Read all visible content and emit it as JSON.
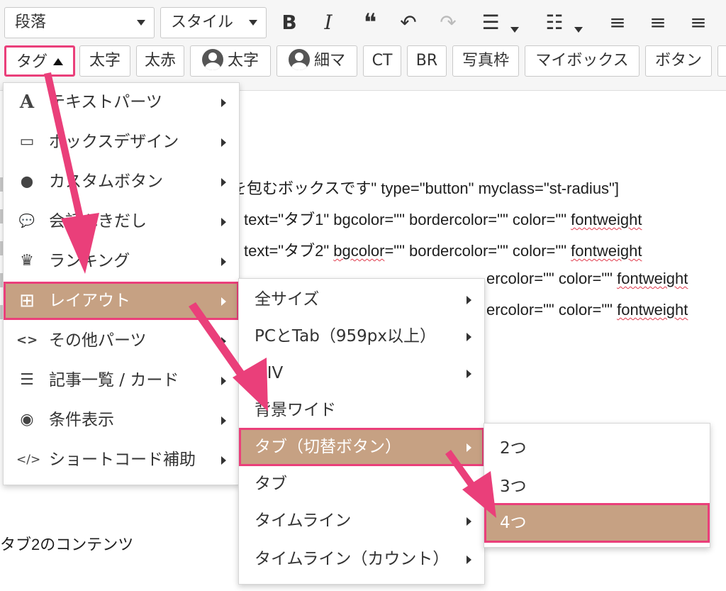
{
  "toolbar": {
    "paragraph_select": "段落",
    "style_select": "スタイル",
    "bold": "B",
    "italic": "I",
    "quote": "❝",
    "undo": "↶",
    "redo": "↷",
    "bullet_list": "☰",
    "numbered_list": "☷",
    "align_left": "≡",
    "align_center": "≡",
    "align_right": "≡"
  },
  "quicktags": {
    "tag": "タグ",
    "bold_jp": "太字",
    "red_bold": "太赤",
    "avatar_bold": "太字",
    "avatar_thin": "細マ",
    "ct": "CT",
    "br": "BR",
    "photo_frame": "写真枠",
    "mybox": "マイボックス",
    "button": "ボタン"
  },
  "editor_lines": {
    "l1": "を包むボックスです\" type=\"button\" myclass=\"st-radius\"]",
    "l2a": "text=\"タブ1\" bgcolor=\"\" bordercolor=\"\" color=\"\" ",
    "l2b": "fontweight",
    "l3a": "text=\"タブ2\" ",
    "l3b": "bgcolor",
    "l3c": "=\"\" bordercolor=\"\" color=\"\" ",
    "l3d": "fontweight",
    "l4a": "ercolor=\"\" color=\"\" ",
    "l4b": "fontweight",
    "l5a": "ercolor=\"\" color=\"\" ",
    "l5b": "fontweight",
    "l6": "タブ2のコンテンツ"
  },
  "menu1": {
    "items": [
      {
        "icon": "A",
        "label": "テキストパーツ"
      },
      {
        "icon": "▭",
        "label": "ボックスデザイン"
      },
      {
        "icon": "⬤",
        "label": "カスタムボタン"
      },
      {
        "icon": "💬",
        "label": "会話ふきだし"
      },
      {
        "icon": "♛",
        "label": "ランキング"
      },
      {
        "icon": "⊞",
        "label": "レイアウト"
      },
      {
        "icon": "<>",
        "label": "その他パーツ"
      },
      {
        "icon": "☰",
        "label": "記事一覧 / カード"
      },
      {
        "icon": "◉",
        "label": "条件表示"
      },
      {
        "icon": "</>",
        "label": "ショートコード補助"
      }
    ]
  },
  "menu2": {
    "items": [
      {
        "label": "全サイズ"
      },
      {
        "label": "PCとTab（959px以上）"
      },
      {
        "label": "DIV"
      },
      {
        "label": "背景ワイド"
      },
      {
        "label": "タブ（切替ボタン）"
      },
      {
        "label": "タブ"
      },
      {
        "label": "タイムライン"
      },
      {
        "label": "タイムライン（カウント）"
      }
    ]
  },
  "menu3": {
    "items": [
      {
        "label": "2つ"
      },
      {
        "label": "3つ"
      },
      {
        "label": "4つ"
      }
    ]
  },
  "colors": {
    "highlight": "#c6a183",
    "annotation_pink": "#ea3f7a"
  }
}
